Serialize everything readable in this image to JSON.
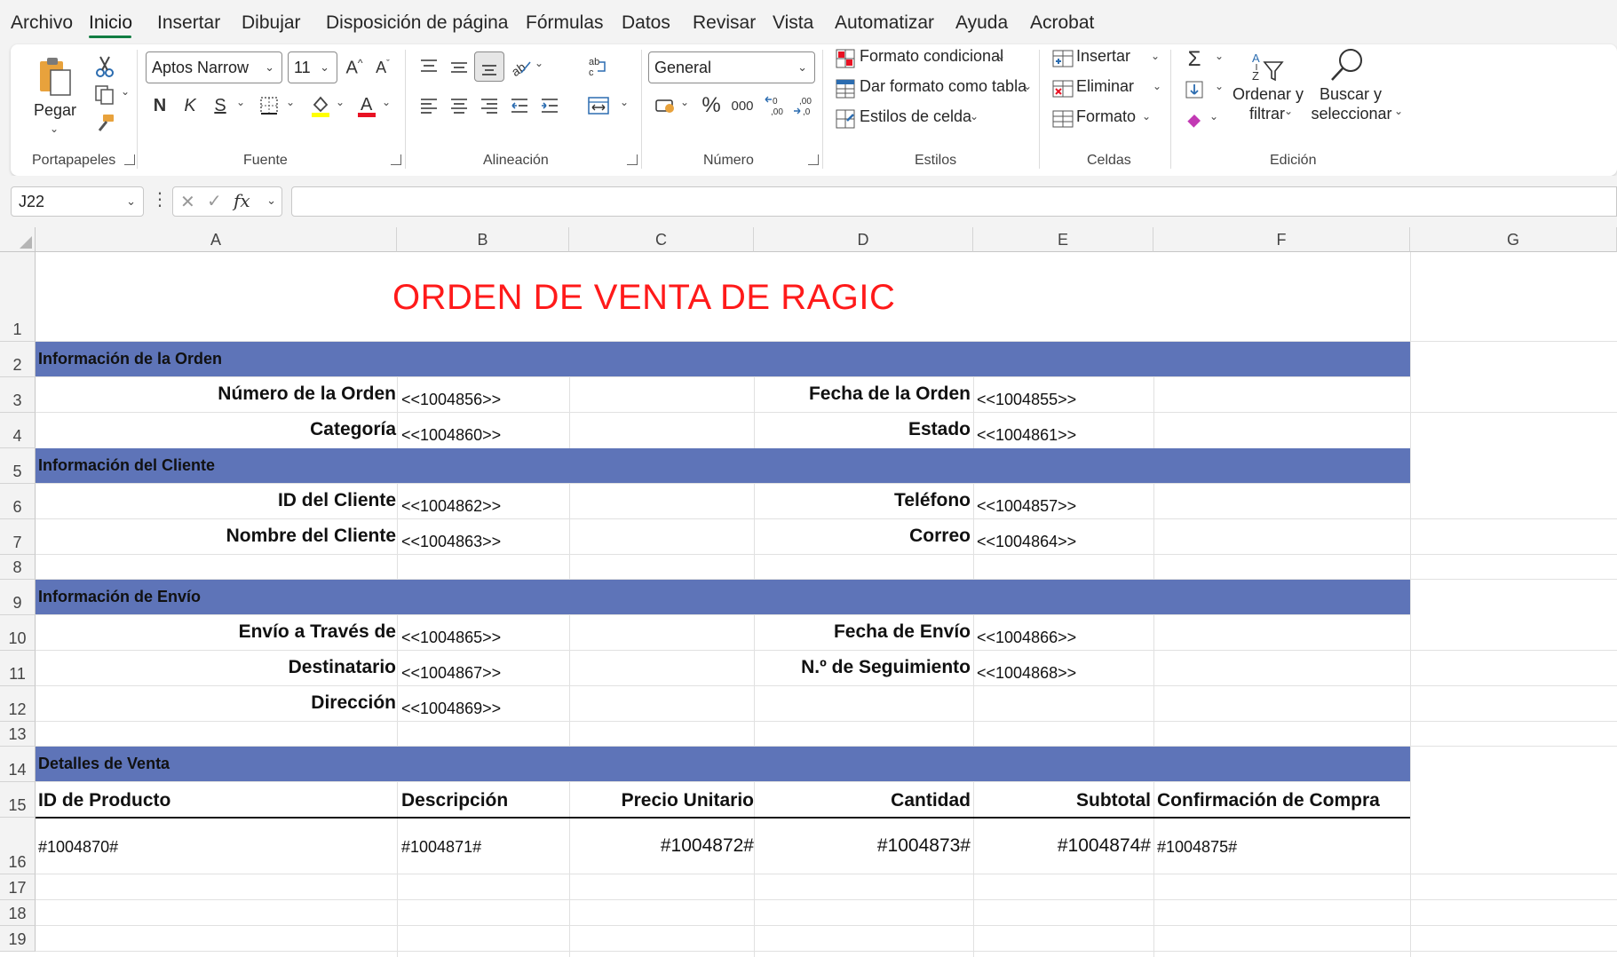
{
  "menu": {
    "tabs": [
      "Archivo",
      "Inicio",
      "Insertar",
      "Dibujar",
      "Disposición de página",
      "Fórmulas",
      "Datos",
      "Revisar",
      "Vista",
      "Automatizar",
      "Ayuda",
      "Acrobat"
    ],
    "active_tab": "Inicio"
  },
  "ribbon": {
    "clipboard": {
      "paste_label": "Pegar",
      "group_label": "Portapapeles"
    },
    "font": {
      "font_name": "Aptos Narrow",
      "font_size": "11",
      "bold": "N",
      "italic": "K",
      "underline": "S",
      "group_label": "Fuente",
      "highlight_color": "#ffff00",
      "font_color": "#e81123"
    },
    "alignment": {
      "group_label": "Alineación"
    },
    "number": {
      "format": "General",
      "percent": "%",
      "thousands": "000",
      "group_label": "Número"
    },
    "styles": {
      "conditional": "Formato condicional",
      "as_table": "Dar formato como tabla",
      "cell_styles": "Estilos de celda",
      "group_label": "Estilos"
    },
    "cells": {
      "insert": "Insertar",
      "delete": "Eliminar",
      "format": "Formato",
      "group_label": "Celdas"
    },
    "editing": {
      "sort_filter": [
        "Ordenar y",
        "filtrar"
      ],
      "find_select": [
        "Buscar y",
        "seleccionar"
      ],
      "group_label": "Edición"
    }
  },
  "formula_bar": {
    "name_box": "J22",
    "fx": "fx",
    "formula": ""
  },
  "columns": [
    "A",
    "B",
    "C",
    "D",
    "E",
    "F",
    "G"
  ],
  "rows": [
    "1",
    "2",
    "3",
    "4",
    "5",
    "6",
    "7",
    "8",
    "9",
    "10",
    "11",
    "12",
    "13",
    "14",
    "15",
    "16",
    "17",
    "18",
    "19"
  ],
  "sheet": {
    "title": "ORDEN DE VENTA DE RAGIC",
    "sections": {
      "order": "Información de la Orden",
      "customer": "Información del Cliente",
      "shipping": "Información de Envío",
      "sales": "Detalles de Venta"
    },
    "fields": {
      "order_number": {
        "label": "Número de la Orden",
        "value": "<<1004856>>"
      },
      "order_date": {
        "label": "Fecha de la Orden",
        "value": "<<1004855>>"
      },
      "category": {
        "label": "Categoría",
        "value": "<<1004860>>"
      },
      "status": {
        "label": "Estado",
        "value": "<<1004861>>"
      },
      "customer_id": {
        "label": "ID del Cliente",
        "value": "<<1004862>>"
      },
      "phone": {
        "label": "Teléfono",
        "value": "<<1004857>>"
      },
      "customer_name": {
        "label": "Nombre del Cliente",
        "value": "<<1004863>>"
      },
      "email": {
        "label": "Correo",
        "value": "<<1004864>>"
      },
      "ship_via": {
        "label": "Envío a Través de",
        "value": "<<1004865>>"
      },
      "ship_date": {
        "label": "Fecha de Envío",
        "value": "<<1004866>>"
      },
      "recipient": {
        "label": "Destinatario",
        "value": "<<1004867>>"
      },
      "tracking": {
        "label": "N.º de Seguimiento",
        "value": "<<1004868>>"
      },
      "address": {
        "label": "Dirección",
        "value": "<<1004869>>"
      }
    },
    "table": {
      "headers": [
        "ID de Producto",
        "Descripción",
        "Precio Unitario",
        "Cantidad",
        "Subtotal",
        "Confirmación de Compra"
      ],
      "row": [
        "#1004870#",
        "#1004871#",
        "#1004872#",
        "#1004873#",
        "#1004874#",
        "#1004875#"
      ]
    }
  }
}
